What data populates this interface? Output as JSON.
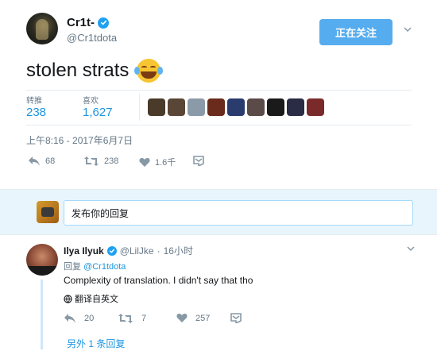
{
  "tweet": {
    "author_name": "Cr1t-",
    "author_handle": "@Cr1tdota",
    "follow_button_label": "正在关注",
    "text": "stolen strats",
    "retweets_label": "转推",
    "retweets_count": "238",
    "likes_label": "喜欢",
    "likes_count": "1,627",
    "timestamp": "上午8:16 - 2017年6月7日",
    "actions": {
      "reply_count": "68",
      "retweet_count": "238",
      "like_count": "1.6千"
    },
    "icons": {
      "verified": "verified-badge-icon",
      "menu": "chevron-down-icon",
      "emoji": "face-with-tears-of-joy-emoji",
      "reply": "reply-icon",
      "retweet": "retweet-icon",
      "like": "heart-icon",
      "dm": "envelope-icon"
    },
    "likers_colors": [
      "#4a3a2a",
      "#5a4636",
      "#8a9aa8",
      "#6a2b1c",
      "#2a3b6e",
      "#5a4a48",
      "#1a1a1a",
      "#2a2b44",
      "#7a2a2a"
    ]
  },
  "reply_composer": {
    "placeholder": "发布你的回复"
  },
  "reply": {
    "author_name": "Ilya Ilyuk",
    "author_handle": "@LilJke",
    "separator": "·",
    "time_ago": "16小时",
    "reply_to_prefix": "回复",
    "reply_to_handle": "@Cr1tdota",
    "text": "Complexity of translation. I didn't say that tho",
    "translate_label": "翻译自英文",
    "actions": {
      "reply_count": "20",
      "retweet_count": "7",
      "like_count": "257"
    }
  },
  "more_replies_label": "另外 1 条回复",
  "colors": {
    "accent": "#1da1f2",
    "link": "#1b95e0",
    "follow_button": "#55acee",
    "muted": "#657786",
    "reply_bar_bg": "#e8f5fd"
  }
}
